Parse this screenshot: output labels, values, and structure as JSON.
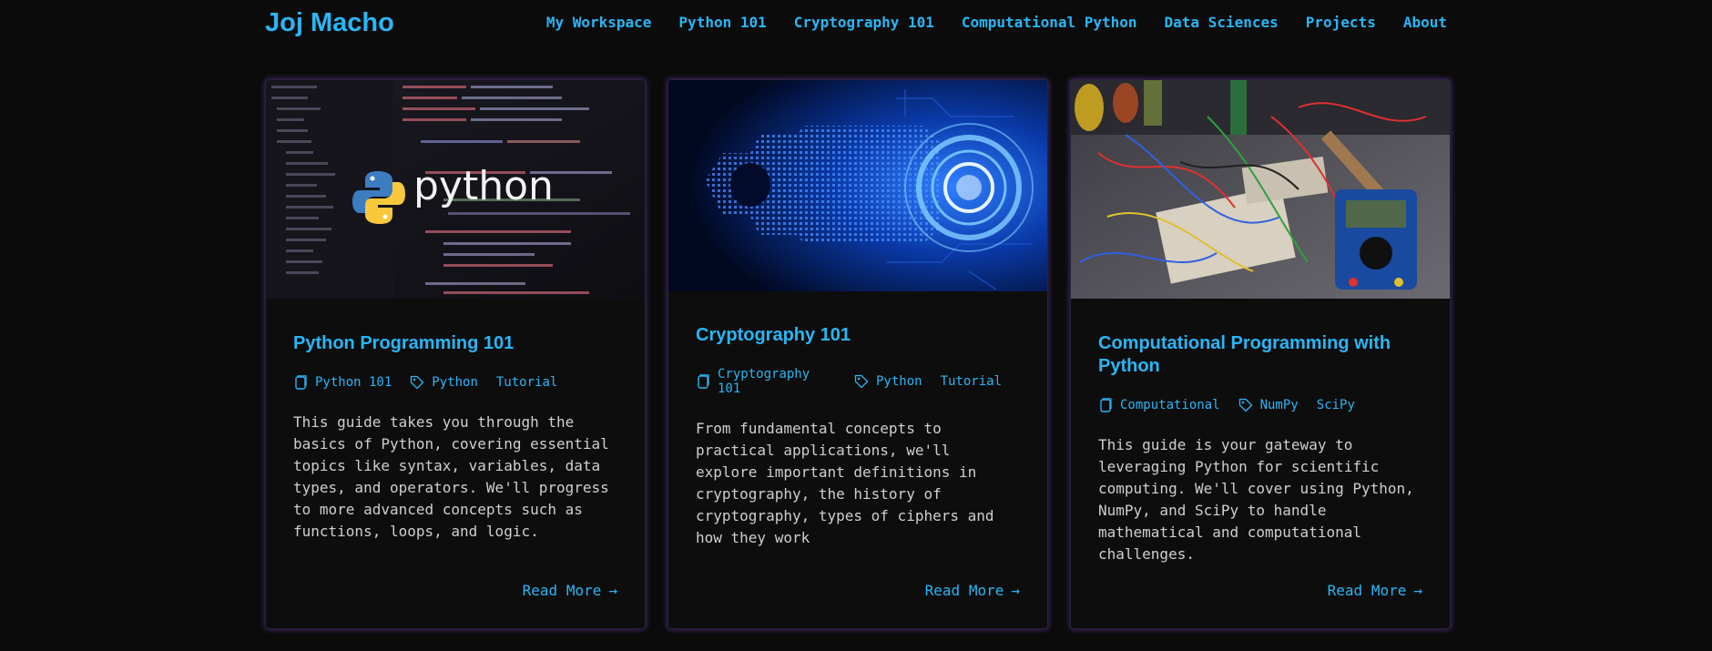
{
  "site": {
    "brand": "Joj Macho"
  },
  "nav": [
    {
      "label": "My Workspace"
    },
    {
      "label": "Python 101"
    },
    {
      "label": "Cryptography 101"
    },
    {
      "label": "Computational Python"
    },
    {
      "label": "Data Sciences"
    },
    {
      "label": "Projects"
    },
    {
      "label": "About"
    }
  ],
  "cards": [
    {
      "title": "Python Programming 101",
      "category": "Python 101",
      "tags": [
        "Python",
        "Tutorial"
      ],
      "description": "This guide takes you through the basics of Python, covering essential topics like syntax, variables, data types, and operators. We'll progress to more advanced concepts such as functions, loops, and logic.",
      "read_more": "Read More",
      "image_text": "python"
    },
    {
      "title": "Cryptography 101",
      "category": "Cryptography 101",
      "tags": [
        "Python",
        "Tutorial"
      ],
      "description": "From fundamental concepts to practical applications, we'll explore important definitions in cryptography, the history of cryptography, types of ciphers and how they work",
      "read_more": "Read More"
    },
    {
      "title": "Computational Programming with Python",
      "category": "Computational",
      "tags": [
        "NumPy",
        "SciPy"
      ],
      "description": "This guide is your gateway to leveraging Python for scientific computing. We'll cover using Python, NumPy, and SciPy to handle mathematical and computational challenges.",
      "read_more": "Read More"
    }
  ],
  "colors": {
    "accent": "#29b6f6",
    "background": "#0b0b0b",
    "card_glow": "#7846c8"
  }
}
